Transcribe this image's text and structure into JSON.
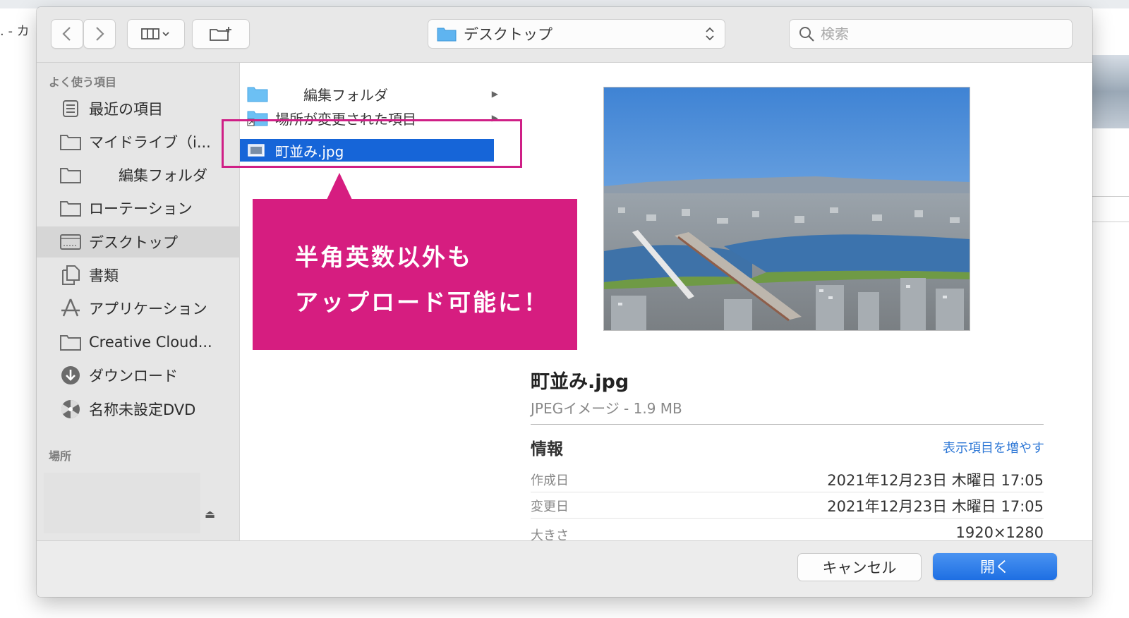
{
  "background": {
    "left_text": ". - カ"
  },
  "toolbar": {
    "path_label": "デスクトップ",
    "search_placeholder": "検索"
  },
  "sidebar": {
    "favorites_heading": "よく使う項目",
    "places_heading": "場所",
    "items": [
      {
        "label": "最近の項目",
        "icon": "recents-icon"
      },
      {
        "label": "マイドライブ（i...",
        "icon": "folder-icon"
      },
      {
        "label": "　　編集フォルダ",
        "icon": "folder-icon"
      },
      {
        "label": "ローテーション",
        "icon": "folder-icon"
      },
      {
        "label": "デスクトップ",
        "icon": "desktop-icon",
        "selected": true
      },
      {
        "label": "書類",
        "icon": "documents-icon"
      },
      {
        "label": "アプリケーション",
        "icon": "applications-icon"
      },
      {
        "label": "Creative Cloud...",
        "icon": "folder-icon"
      },
      {
        "label": "ダウンロード",
        "icon": "download-icon"
      },
      {
        "label": "名称未設定DVD",
        "icon": "dvd-icon"
      }
    ]
  },
  "files": [
    {
      "name": "　　編集フォルダ",
      "icon": "folder-icon",
      "has_children": true
    },
    {
      "name": "場所が変更された項目",
      "icon": "alias-folder-icon",
      "has_children": true
    },
    {
      "name": "町並み.jpg",
      "icon": "image-file-icon",
      "selected": true
    }
  ],
  "preview": {
    "filename": "町並み.jpg",
    "subtitle": "JPEGイメージ - 1.9 MB",
    "info_heading": "情報",
    "more_link": "表示項目を増やす",
    "rows": [
      {
        "key": "作成日",
        "value": "2021年12月23日 木曜日 17:05"
      },
      {
        "key": "変更日",
        "value": "2021年12月23日 木曜日 17:05"
      },
      {
        "key": "大きさ",
        "value": "1920×1280"
      }
    ]
  },
  "buttons": {
    "cancel": "キャンセル",
    "open": "開く"
  },
  "annotation": {
    "line1": "半角英数以外も",
    "line2": "アップロード可能に！",
    "color": "#d61d80"
  },
  "colors": {
    "selection": "#1665d8",
    "accent_link": "#2f78d6"
  }
}
